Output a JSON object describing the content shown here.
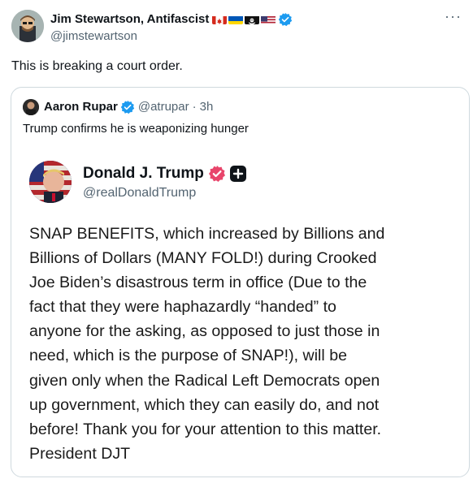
{
  "tweet": {
    "author_name": "Jim Stewartson, Antifascist",
    "author_handle": "@jimstewartson",
    "more_glyph": "···",
    "text": "This is breaking a court order."
  },
  "quote": {
    "author_name": "Aaron Rupar",
    "author_handle": "@atrupar",
    "separator": "·",
    "time": "3h",
    "text": "Trump confirms he is weaponizing hunger",
    "embedded": {
      "author_name": "Donald J. Trump",
      "author_handle": "@realDonaldTrump",
      "lines": [
        "SNAP BENEFITS, which increased by Billions and",
        "Billions of Dollars (MANY FOLD!) during Crooked",
        "Joe Biden’s disastrous term in office (Due to the",
        "fact that they were haphazardly “handed” to",
        "anyone for the asking, as opposed to just those in",
        "need, which is the purpose of SNAP!), will be",
        "given only when the Radical Left Democrats open",
        "up government, which they can easily do, and not",
        "before! Thank you for your attention to this matter.",
        "President DJT"
      ]
    }
  },
  "colors": {
    "verified_blue": "#1d9bf0",
    "muted_text": "#536471",
    "border": "#cfd9de"
  },
  "icons": [
    "verified-badge-icon",
    "more-options-icon",
    "plus-icon",
    "canada-flag-icon",
    "ukraine-flag-icon",
    "pirate-flag-icon",
    "us-flag-icon"
  ]
}
